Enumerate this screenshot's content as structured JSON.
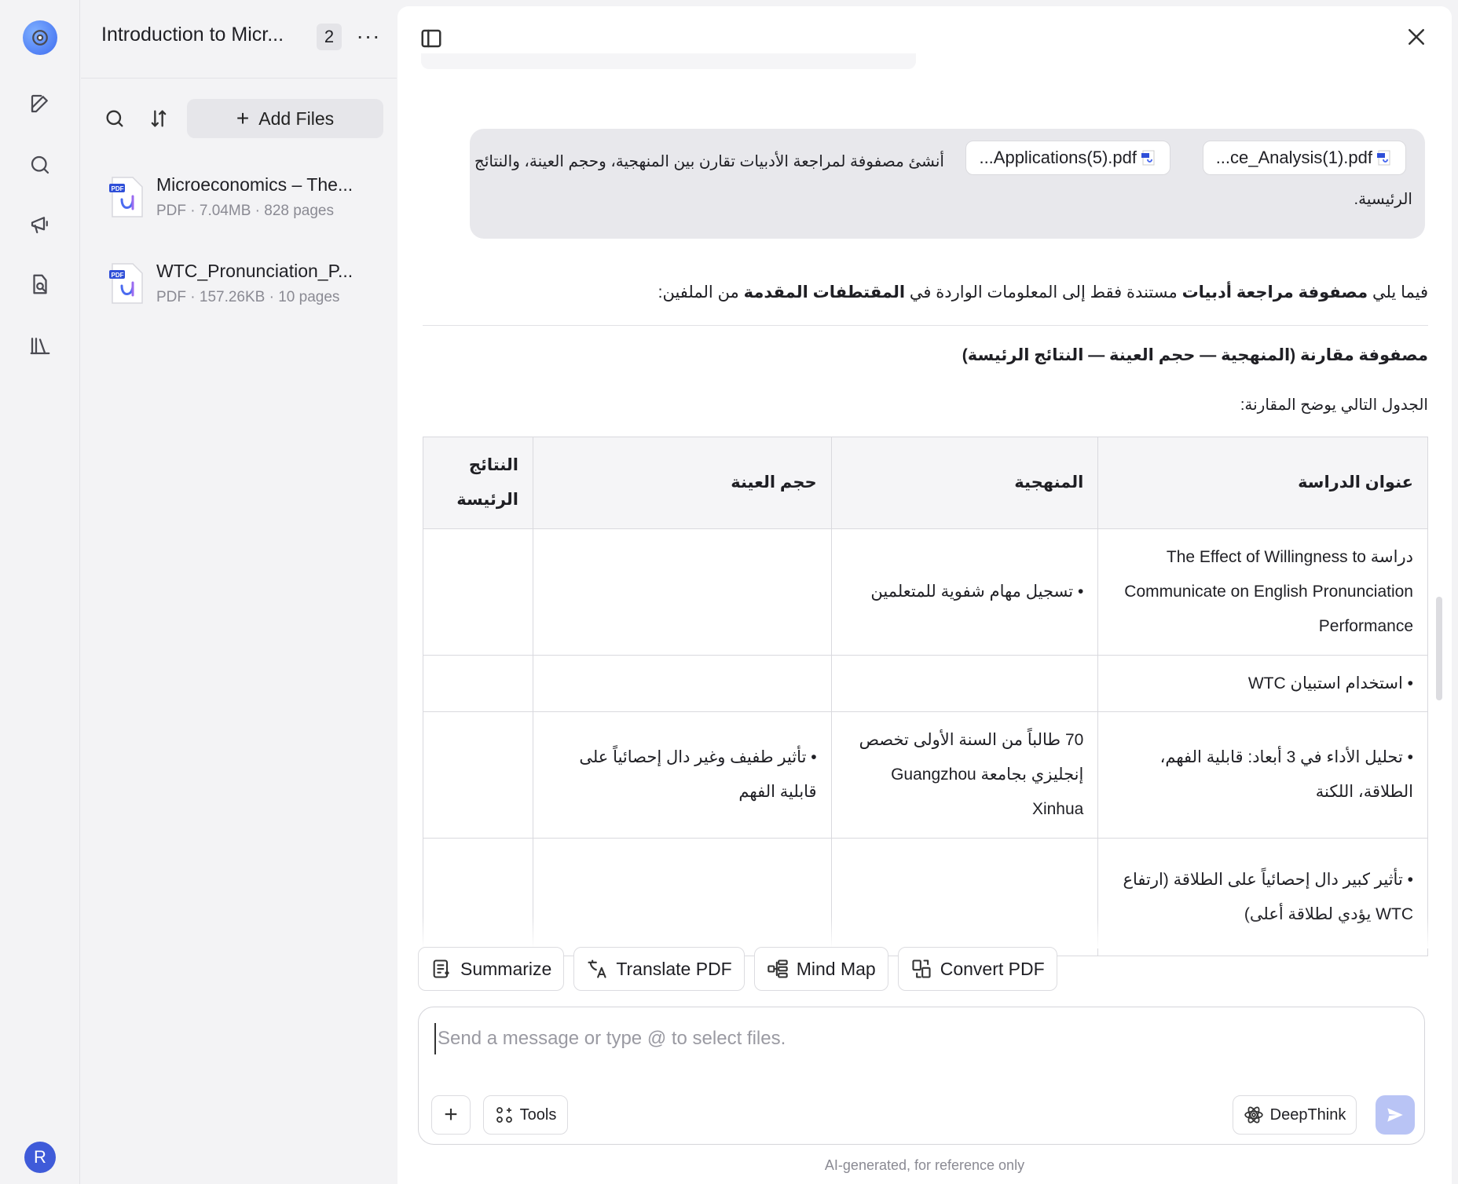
{
  "sidebar_rail": {
    "icons": [
      "app-logo-icon",
      "edit-icon",
      "search-icon",
      "megaphone-icon",
      "document-search-icon",
      "library-icon"
    ],
    "avatar_letter": "R"
  },
  "files_panel": {
    "title": "Introduction to Micr...",
    "count": "2",
    "more": "···",
    "add_files_label": "Add Files",
    "files": [
      {
        "name": "Microeconomics – The...",
        "meta": "PDF · 7.04MB · 828 pages"
      },
      {
        "name": "WTC_Pronunciation_P...",
        "meta": "PDF · 157.26KB · 10 pages"
      }
    ]
  },
  "chat": {
    "user_message": {
      "attachments": [
        "...ce_Analysis(1).pdf",
        "...Applications(5).pdf"
      ],
      "text_line1": "أنشئ مصفوفة لمراجعة الأدبيات تقارن بين المنهجية، وحجم العينة، والنتائج",
      "text_line2": "الرئيسية."
    },
    "answer": {
      "intro_pre": "فيما يلي ",
      "intro_bold1": "مصفوفة مراجعة أدبيات",
      "intro_mid": " مستندة فقط إلى المعلومات الواردة في ",
      "intro_bold2": "المقتطفات المقدمة",
      "intro_post": " من الملفين:",
      "heading": "مصفوفة مقارنة (المنهجية — حجم العينة — النتائج الرئيسة)",
      "subtitle": "الجدول التالي يوضح المقارنة:",
      "table": {
        "headers": [
          "عنوان الدراسة",
          "المنهجية",
          "حجم العينة",
          "النتائج الرئيسة"
        ],
        "rows": [
          [
            "دراسة The Effect of Willingness to Communicate on English Pronunciation Performance",
            "• تسجيل مهام شفوية للمتعلمين",
            "",
            ""
          ],
          [
            "• استخدام استبيان WTC",
            "",
            "",
            ""
          ],
          [
            "• تحليل الأداء في 3 أبعاد: قابلية الفهم، الطلاقة، اللكنة",
            "70 طالباً من السنة الأولى تخصص إنجليزي بجامعة Guangzhou Xinhua",
            "• تأثير طفيف وغير دال إحصائياً على قابلية الفهم",
            ""
          ],
          [
            "• تأثير كبير دال إحصائياً على الطلاقة (ارتفاع WTC يؤدي لطلاقة أعلى)",
            "",
            "",
            ""
          ]
        ]
      }
    },
    "quick_actions": [
      "Summarize",
      "Translate PDF",
      "Mind Map",
      "Convert PDF"
    ],
    "composer": {
      "placeholder": "Send a message or type @ to select files.",
      "tools_label": "Tools",
      "deepthink_label": "DeepThink"
    },
    "disclaimer": "AI-generated, for reference only"
  }
}
